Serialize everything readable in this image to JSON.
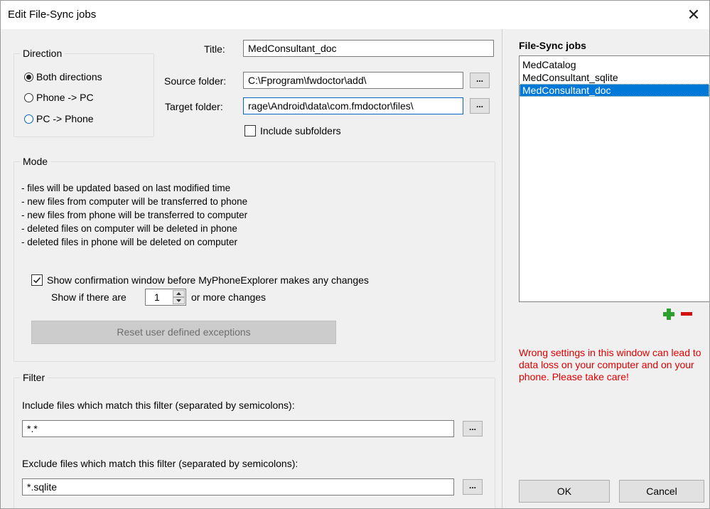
{
  "window": {
    "title": "Edit File-Sync jobs",
    "close_glyph": "✕"
  },
  "direction": {
    "legend": "Direction",
    "options": [
      {
        "label": "Both directions",
        "selected": true
      },
      {
        "label": "Phone -> PC",
        "selected": false
      },
      {
        "label": "PC -> Phone",
        "selected": false
      }
    ]
  },
  "form": {
    "title_label": "Title:",
    "title_value": "MedConsultant_doc",
    "source_label": "Source folder:",
    "source_value": "C:\\Fprogram\\fwdoctor\\add\\",
    "target_label": "Target folder:",
    "target_value": "rage\\Android\\data\\com.fmdoctor\\files\\",
    "browse_label": "...",
    "include_subfolders_label": "Include subfolders",
    "include_subfolders_checked": false
  },
  "mode": {
    "legend": "Mode",
    "lines": [
      "- files will be updated based on last modified time",
      "- new files from computer will be transferred to phone",
      "- new files from phone will be transferred to computer",
      "- deleted files on computer will be deleted in phone",
      "- deleted files in phone will be deleted on computer"
    ],
    "confirm_label": "Show confirmation window before MyPhoneExplorer makes any changes",
    "confirm_checked": true,
    "show_if_prefix": "Show if there are",
    "show_if_value": "1",
    "show_if_suffix": "or more changes",
    "reset_button": "Reset user defined exceptions"
  },
  "filter": {
    "legend": "Filter",
    "include_label": "Include files which match this filter (separated by semicolons):",
    "include_value": "*.*",
    "exclude_label": "Exclude files which match this filter (separated by semicolons):",
    "exclude_value": "*.sqlite",
    "browse_label": "..."
  },
  "jobs": {
    "heading": "File-Sync jobs",
    "items": [
      {
        "label": "MedCatalog",
        "selected": false
      },
      {
        "label": "MedConsultant_sqlite",
        "selected": false
      },
      {
        "label": "MedConsultant_doc",
        "selected": true
      }
    ]
  },
  "warning": "Wrong settings in this window can lead to data loss on your computer and on your phone. Please take care!",
  "buttons": {
    "ok": "OK",
    "cancel": "Cancel"
  },
  "colors": {
    "add": "#2e9e2e",
    "remove": "#d01010",
    "warning": "#e00000",
    "selection": "#0078d7"
  }
}
